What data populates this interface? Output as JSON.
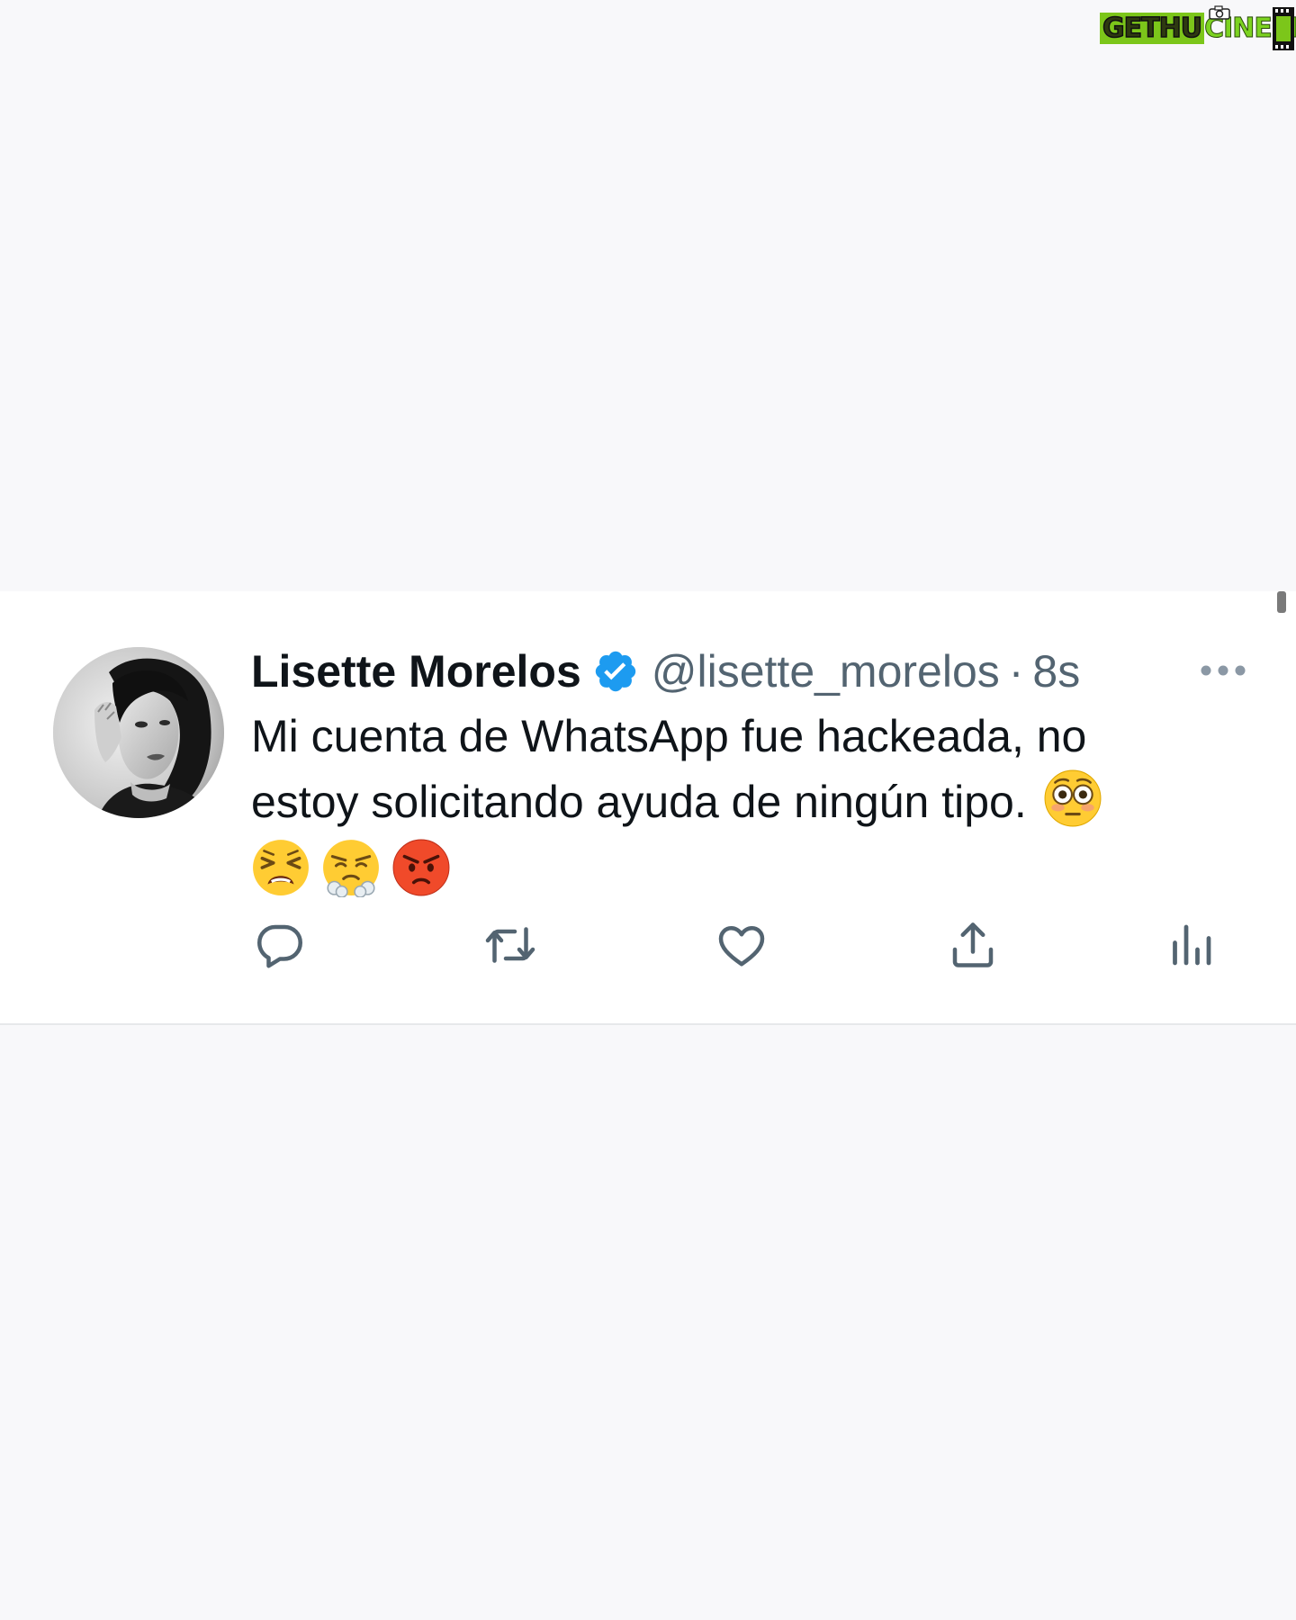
{
  "watermark": {
    "brand_part_a": "GETHU",
    "brand_part_b": "CINEMA",
    "icons": [
      "camera-icon",
      "film-strip-icon"
    ]
  },
  "tweet": {
    "author": {
      "display_name": "Lisette Morelos",
      "verified": true,
      "handle": "@lisette_morelos",
      "avatar": "profile-photo (black and white portrait)"
    },
    "separator": "·",
    "timestamp": "8s",
    "more_icon": "more-horizontal-icon",
    "text_line_1": "Mi cuenta de WhatsApp fue hackeada, no",
    "text_line_2": "estoy solicitando ayuda de ningún tipo.",
    "emojis": [
      "flushed-face",
      "tired-face",
      "face-with-steam-from-nose",
      "pouting-face"
    ],
    "actions": [
      {
        "name": "reply",
        "icon": "reply-icon"
      },
      {
        "name": "retweet",
        "icon": "retweet-icon"
      },
      {
        "name": "like",
        "icon": "heart-icon"
      },
      {
        "name": "share",
        "icon": "share-icon"
      },
      {
        "name": "analytics",
        "icon": "analytics-icon"
      }
    ]
  },
  "colors": {
    "page_background": "#f8f8fa",
    "card_background": "#ffffff",
    "primary_text": "#0f1419",
    "secondary_text": "#536471",
    "verified_blue": "#1d9bf0",
    "watermark_green": "#7cc61a"
  }
}
